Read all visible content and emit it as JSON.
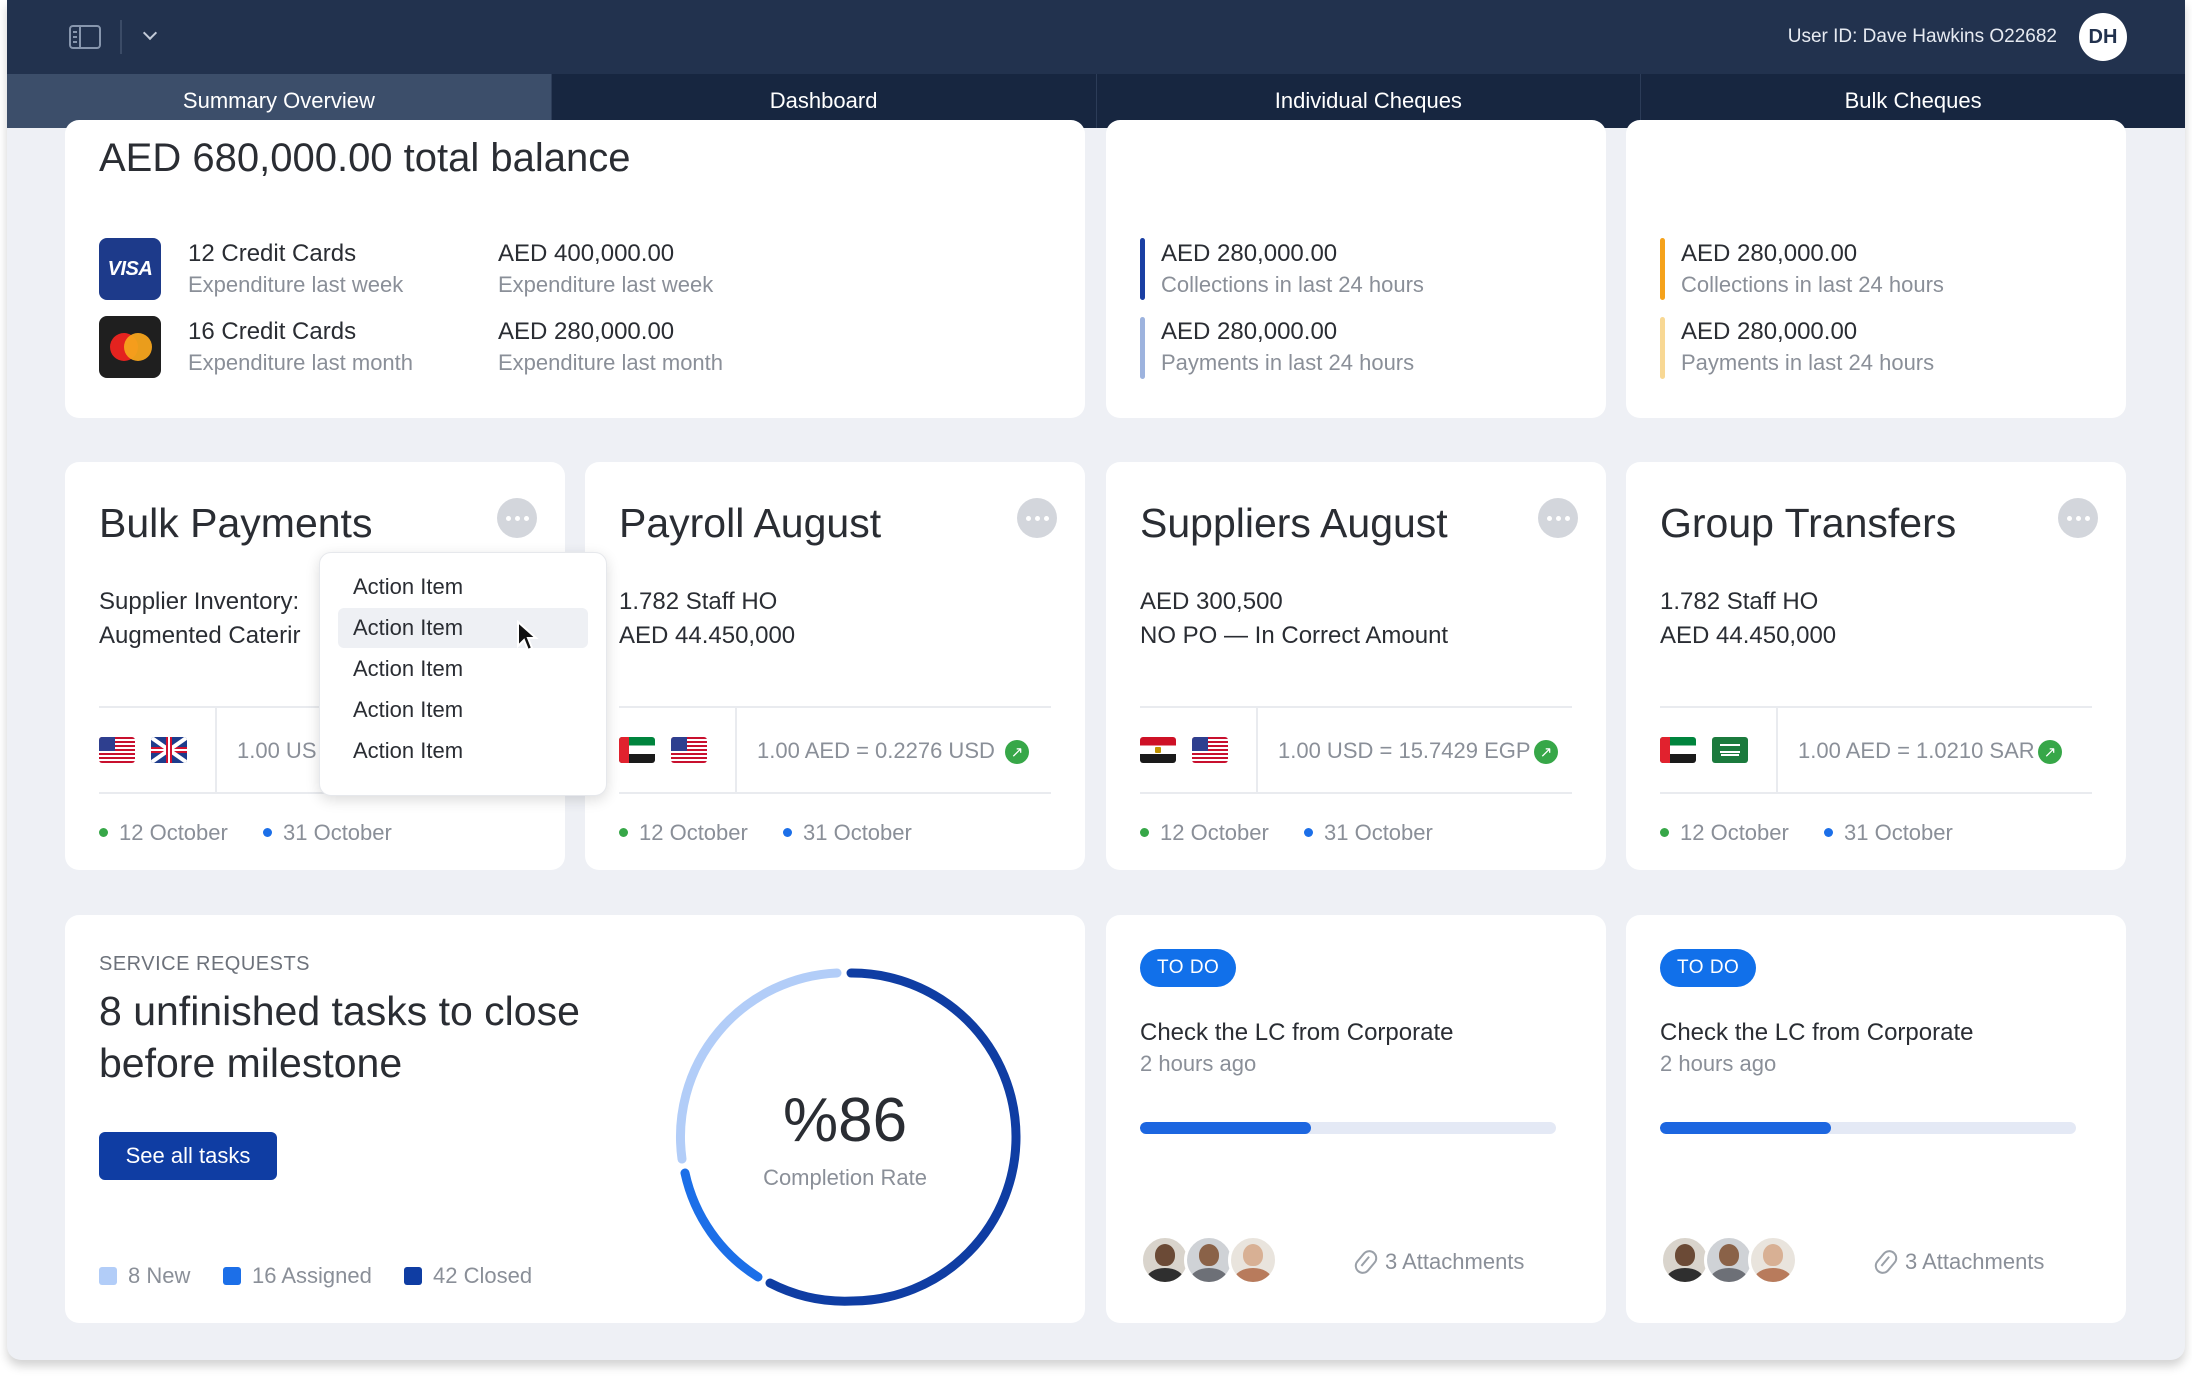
{
  "header": {
    "user_id_text": "User ID: Dave Hawkins O22682",
    "avatar_initials": "DH"
  },
  "tabs": [
    {
      "label": "Summary Overview",
      "active": true
    },
    {
      "label": "Dashboard"
    },
    {
      "label": "Individual Cheques"
    },
    {
      "label": "Bulk Cheques"
    }
  ],
  "balance_card": {
    "title": "AED 680,000.00 total balance",
    "rows": [
      {
        "icon": "visa-card-icon",
        "count": "12 Credit Cards",
        "count_sub": "Expenditure last week",
        "amount": "AED 400,000.00",
        "amount_sub": "Expenditure last week",
        "icon_text": "VISA"
      },
      {
        "icon": "mastercard-icon",
        "count": "16 Credit Cards",
        "count_sub": "Expenditure last month",
        "amount": "AED 280,000.00",
        "amount_sub": "Expenditure last month"
      }
    ]
  },
  "flow_card_1": {
    "rows": [
      {
        "amount": "AED 280,000.00",
        "sub": "Collections in last 24 hours",
        "color": "#1a3fa3"
      },
      {
        "amount": "AED 280,000.00",
        "sub": "Payments in last 24 hours",
        "color": "#9db3de"
      }
    ]
  },
  "flow_card_2": {
    "rows": [
      {
        "amount": "AED 280,000.00",
        "sub": "Collections in last 24 hours",
        "color": "#f5a21b"
      },
      {
        "amount": "AED 280,000.00",
        "sub": "Payments in last 24 hours",
        "color": "#f8d894"
      }
    ]
  },
  "payment_cards": [
    {
      "title": "Bulk Payments",
      "line1": "Supplier Inventory:",
      "line2": "Augmented Caterir",
      "rate": "1.00 US",
      "start": "12 October",
      "end": "31 October"
    },
    {
      "title": "Payroll August",
      "line1": "1.782 Staff HO",
      "line2": "AED 44.450,000",
      "rate": "1.00 AED = 0.2276 USD",
      "start": "12 October",
      "end": "31 October"
    },
    {
      "title": "Suppliers August",
      "line1": "AED 300,500",
      "line2": "NO PO — In Correct Amount",
      "rate": "1.00 USD = 15.7429 EGP",
      "start": "12 October",
      "end": "31 October"
    },
    {
      "title": "Group Transfers",
      "line1": "1.782 Staff HO",
      "line2": "AED 44.450,000",
      "rate": "1.00 AED = 1.0210 SAR",
      "start": "12 October",
      "end": "31 October"
    }
  ],
  "dropdown": {
    "items": [
      "Action Item",
      "Action Item",
      "Action Item",
      "Action Item",
      "Action Item"
    ],
    "hovered_index": 1
  },
  "service_requests": {
    "label": "SERVICE REQUESTS",
    "title": "8 unfinished tasks to close before milestone",
    "button": "See all tasks",
    "legend": [
      {
        "label": "8 New",
        "color": "#b2cdf8"
      },
      {
        "label": "16 Assigned",
        "color": "#1c6fe8"
      },
      {
        "label": "42 Closed",
        "color": "#0f3da3"
      }
    ],
    "completion_value": "%86",
    "completion_label": "Completion Rate"
  },
  "todo_cards": [
    {
      "badge": "TO DO",
      "title": "Check the LC from Corporate",
      "time": "2 hours ago",
      "progress": 0.41,
      "attachments": "3 Attachments"
    },
    {
      "badge": "TO DO",
      "title": "Check the LC from Corporate",
      "time": "2 hours ago",
      "progress": 0.41,
      "attachments": "3 Attachments"
    }
  ],
  "colors": {
    "navy": "#22324e",
    "tab_bar": "#172640",
    "tab_active": "#3c4e6a",
    "go_green": "#37a748",
    "start_dot": "#37a748",
    "end_dot": "#1c6fe8"
  }
}
